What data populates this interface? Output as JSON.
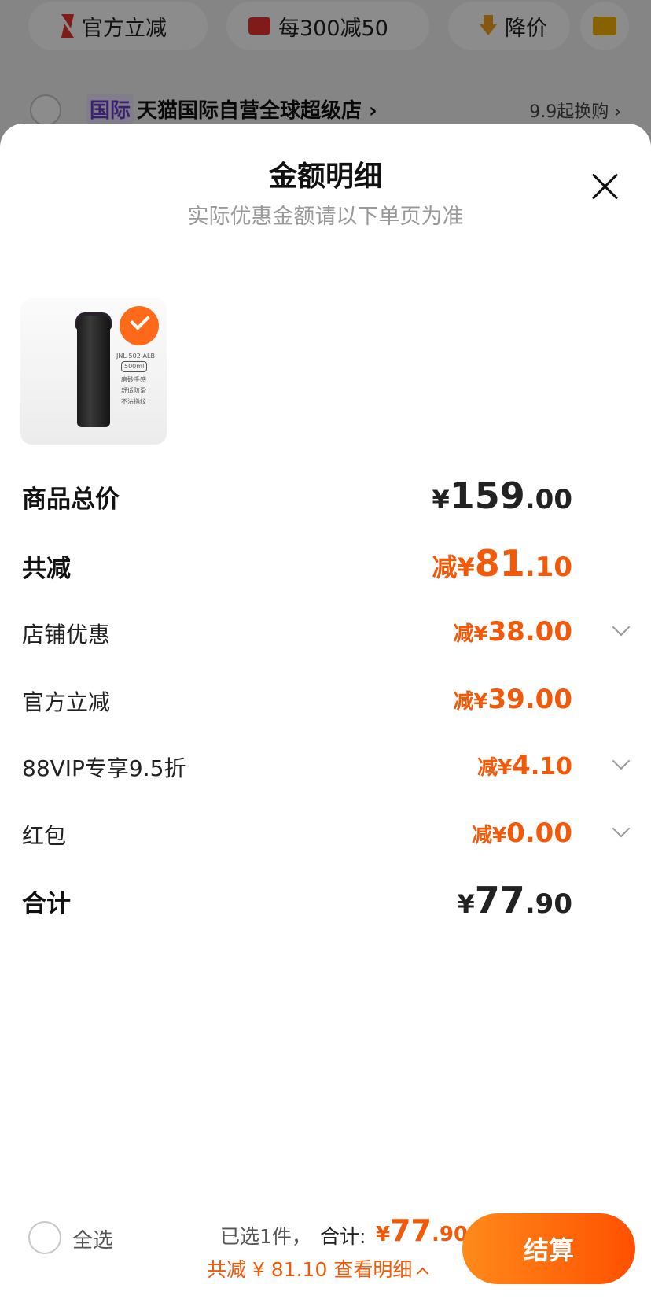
{
  "background": {
    "chips": [
      {
        "label": "官方立减",
        "icon": "lightning-icon"
      },
      {
        "label": "每300减50",
        "icon": "shop-icon"
      },
      {
        "label": "降价",
        "icon": "price-down-icon"
      },
      {
        "label": "",
        "icon": "folder-icon"
      }
    ],
    "store": {
      "tag": "国际",
      "name": "天猫国际自营全球超级店 ›",
      "swap_buy": "9.9起换购 ›"
    }
  },
  "sheet": {
    "title": "金额明细",
    "subtitle": "实际优惠金额请以下单页为准"
  },
  "product": {
    "image_lines": [
      "JNL-502-ALB",
      "500ml",
      "磨砂手感",
      "舒适防滑",
      "不沾指纹"
    ]
  },
  "breakdown": {
    "goods_total": {
      "label": "商品总价",
      "prefix": "¥",
      "int": "159",
      "dec": ".00"
    },
    "total_reduce": {
      "label": "共减",
      "prefix": "减¥",
      "int": "81",
      "dec": ".10"
    },
    "items": [
      {
        "label": "店铺优惠",
        "prefix": "减¥",
        "int": "38",
        "dec": ".00",
        "expandable": true
      },
      {
        "label": "官方立减",
        "prefix": "减¥",
        "int": "39",
        "dec": ".00",
        "expandable": false
      },
      {
        "label": "88VIP专享9.5折",
        "prefix": "减¥",
        "int": "4",
        "dec": ".10",
        "expandable": true
      },
      {
        "label": "红包",
        "prefix": "减¥",
        "int": "0",
        "dec": ".00",
        "expandable": true
      }
    ],
    "sum": {
      "label": "合计",
      "prefix": "¥",
      "int": "77",
      "dec": ".90"
    }
  },
  "bottom": {
    "select_all": "全选",
    "selected_count": "已选1件，",
    "total_label": "合计:",
    "total_prefix": "¥",
    "total_int": "77",
    "total_dec": ".90",
    "discount_text": "共减 ¥ 81.10  查看明细",
    "checkout": "结算"
  },
  "colors": {
    "accent": "#f25a0a",
    "checkout_start": "#ff8a1a",
    "checkout_end": "#ff5000"
  }
}
